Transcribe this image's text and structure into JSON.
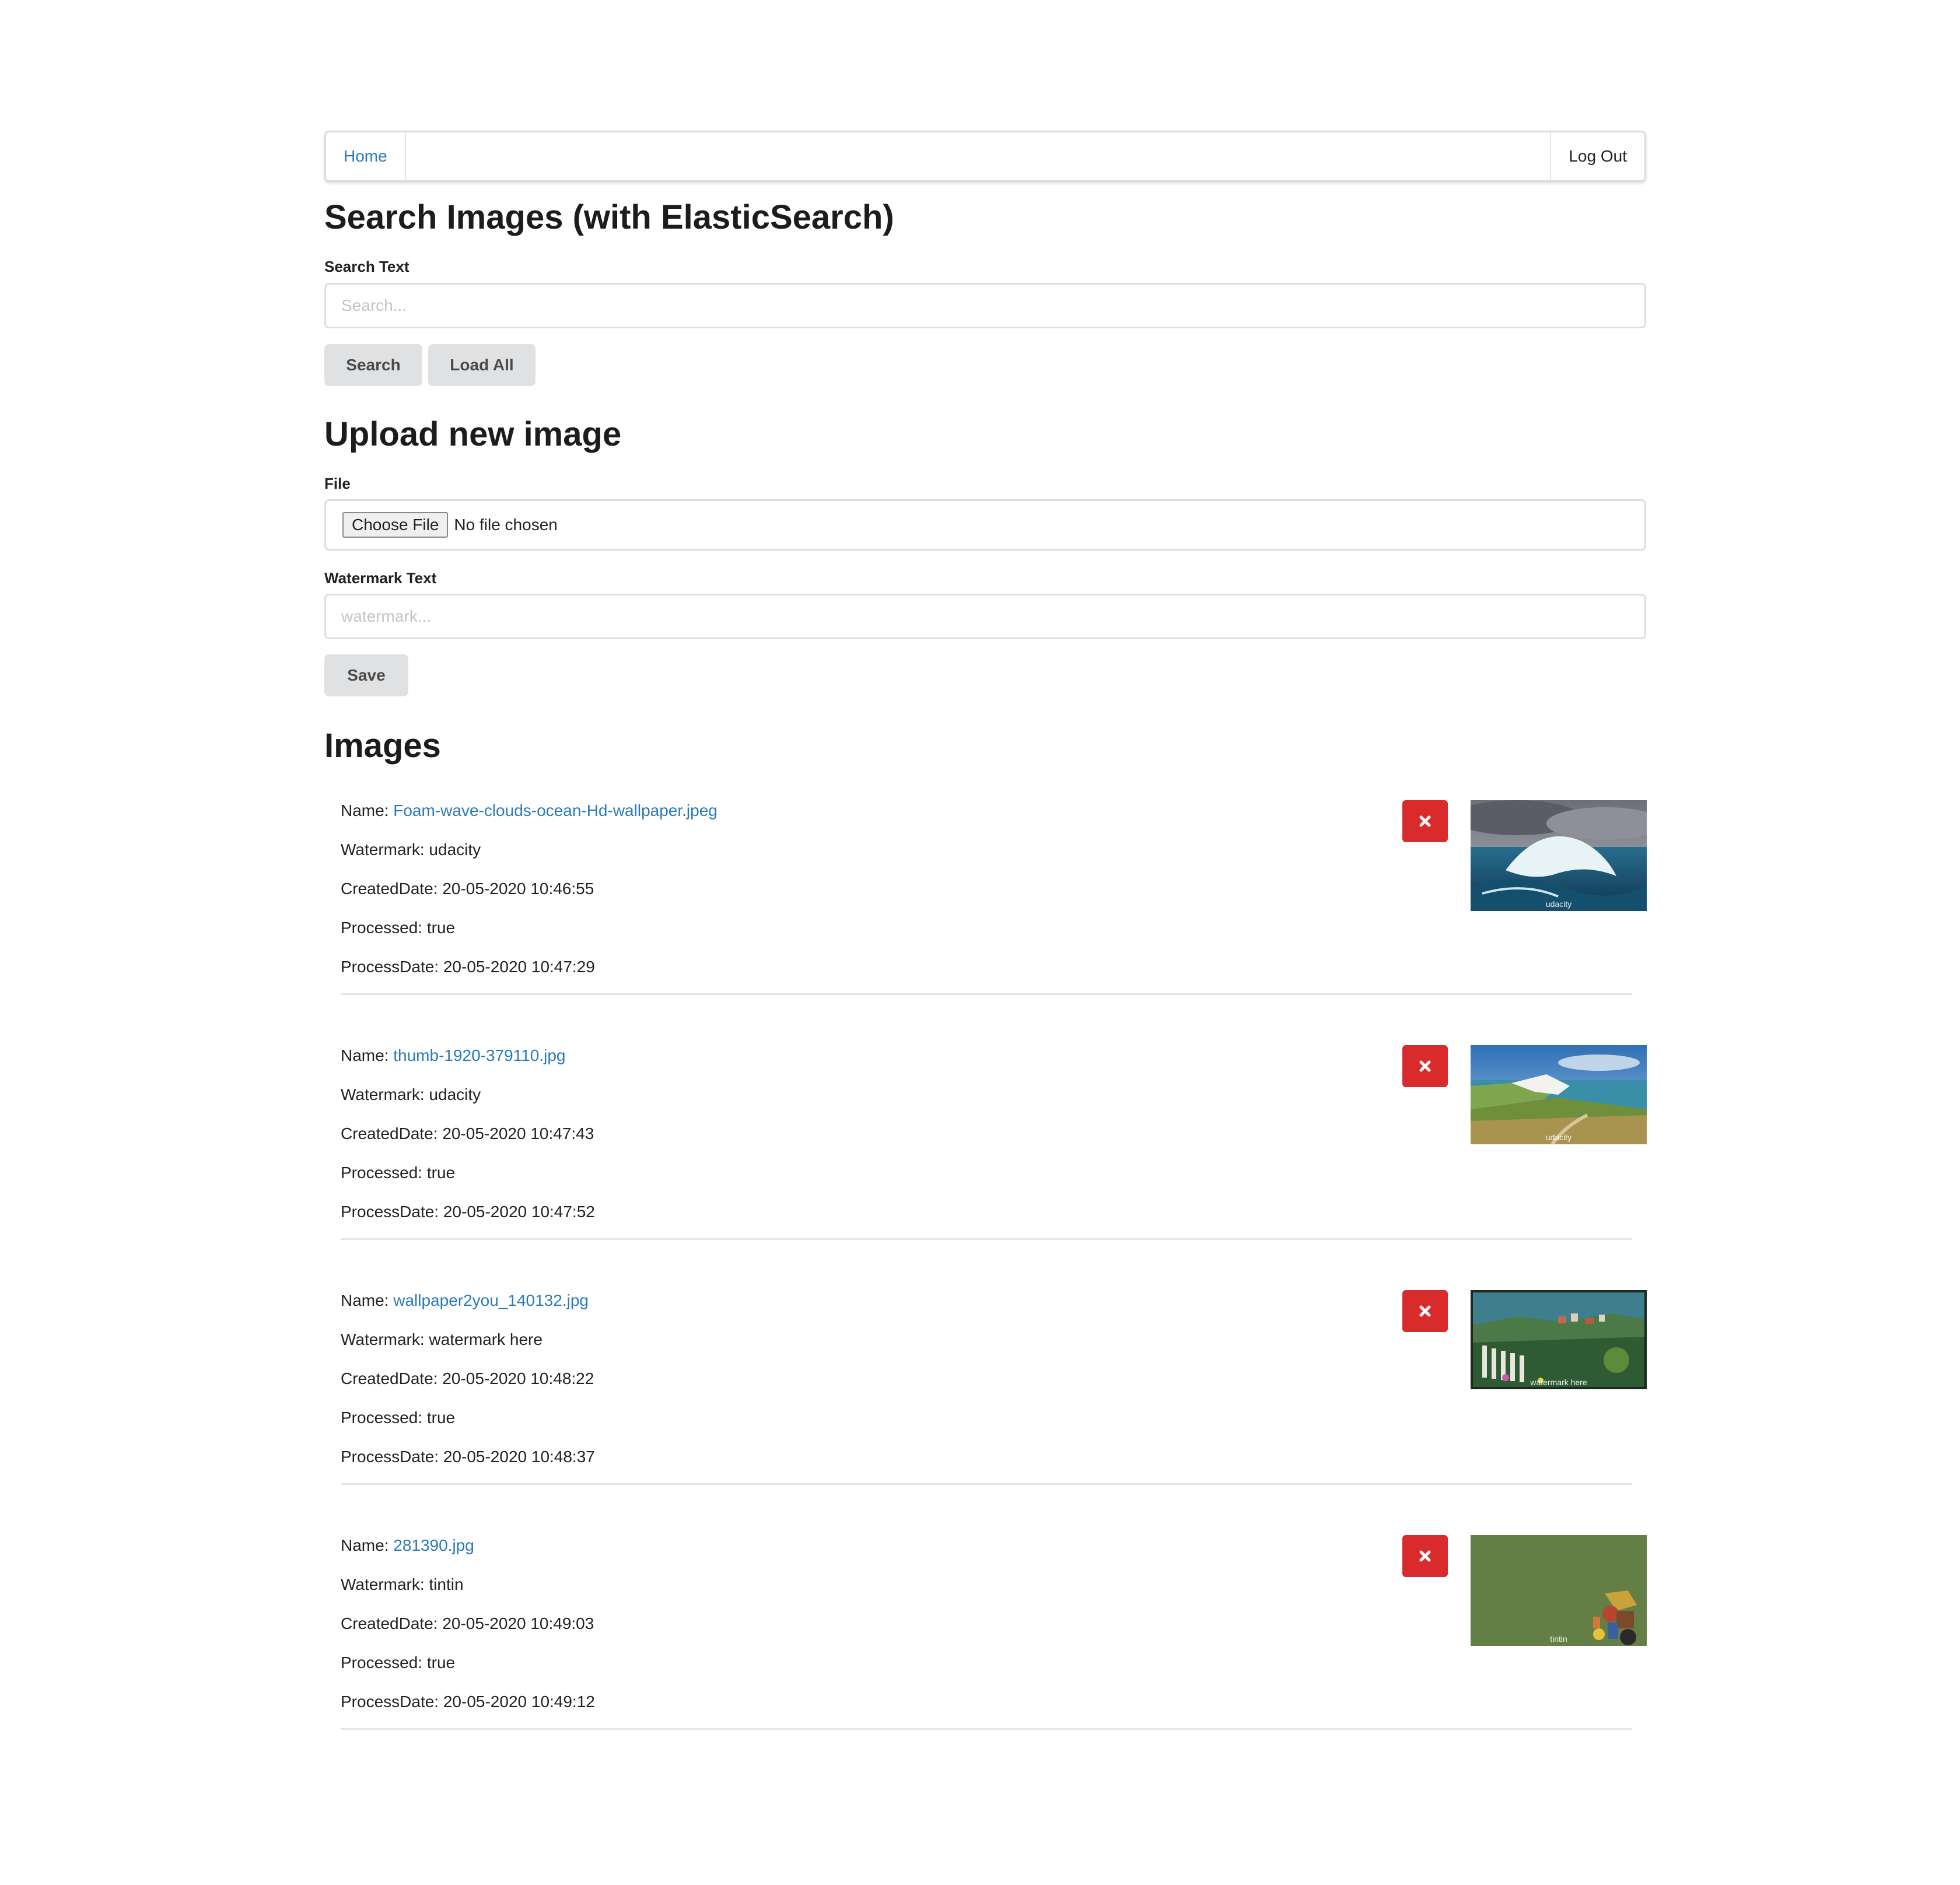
{
  "nav": {
    "home": "Home",
    "logout": "Log Out"
  },
  "search": {
    "title": "Search Images (with ElasticSearch)",
    "label": "Search Text",
    "placeholder": "Search...",
    "search_button": "Search",
    "load_all_button": "Load All"
  },
  "upload": {
    "title": "Upload new image",
    "file_label": "File",
    "choose_file": "Choose File",
    "no_file": "No file chosen",
    "watermark_label": "Watermark Text",
    "watermark_placeholder": "watermark...",
    "save_button": "Save"
  },
  "images": {
    "title": "Images",
    "labels": {
      "name": "Name: ",
      "watermark": "Watermark: ",
      "created": "CreatedDate: ",
      "processed": "Processed: ",
      "process_date": "ProcessDate: "
    },
    "items": [
      {
        "name": "Foam-wave-clouds-ocean-Hd-wallpaper.jpeg",
        "watermark": "udacity",
        "created": "20-05-2020 10:46:55",
        "processed": "true",
        "process_date": "20-05-2020 10:47:29",
        "thumb_watermark": "udacity"
      },
      {
        "name": "thumb-1920-379110.jpg",
        "watermark": "udacity",
        "created": "20-05-2020 10:47:43",
        "processed": "true",
        "process_date": "20-05-2020 10:47:52",
        "thumb_watermark": "udacity"
      },
      {
        "name": "wallpaper2you_140132.jpg",
        "watermark": "watermark here",
        "created": "20-05-2020 10:48:22",
        "processed": "true",
        "process_date": "20-05-2020 10:48:37",
        "thumb_watermark": "watermark here"
      },
      {
        "name": "281390.jpg",
        "watermark": "tintin",
        "created": "20-05-2020 10:49:03",
        "processed": "true",
        "process_date": "20-05-2020 10:49:12",
        "thumb_watermark": "tintin"
      }
    ]
  },
  "icons": {
    "delete": "close-icon"
  },
  "colors": {
    "link": "#2a7ab9",
    "delete_button": "#d92b2b",
    "button_bg": "#e0e1e2"
  }
}
